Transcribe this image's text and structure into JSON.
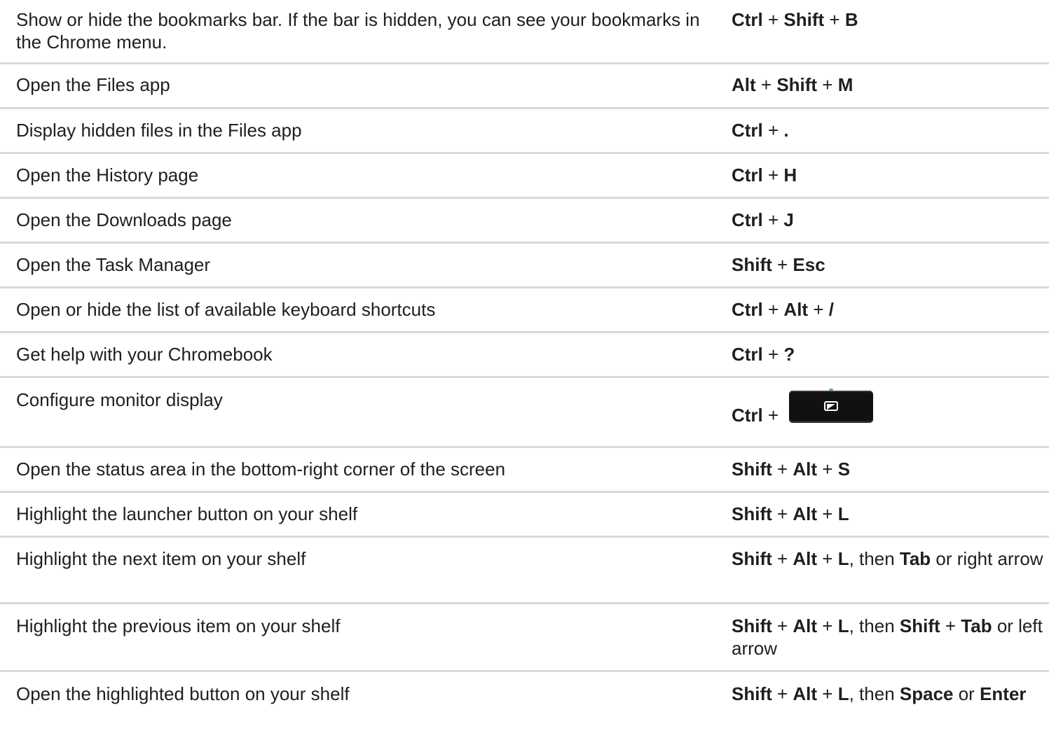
{
  "rows": [
    {
      "desc": "Show or hide the bookmarks bar. If the bar is hidden, you can see your bookmarks in the Chrome menu.",
      "keys": [
        {
          "b": "Ctrl"
        },
        {
          "t": " + "
        },
        {
          "b": "Shift"
        },
        {
          "t": " + "
        },
        {
          "b": "B"
        }
      ]
    },
    {
      "desc": "Open the Files app",
      "keys": [
        {
          "b": "Alt"
        },
        {
          "t": " + "
        },
        {
          "b": "Shift"
        },
        {
          "t": " + "
        },
        {
          "b": "M"
        }
      ]
    },
    {
      "desc": "Display hidden files in the Files app",
      "keys": [
        {
          "b": "Ctrl"
        },
        {
          "t": " + "
        },
        {
          "b": "."
        }
      ]
    },
    {
      "desc": "Open the History page",
      "keys": [
        {
          "b": "Ctrl"
        },
        {
          "t": " + "
        },
        {
          "b": "H"
        }
      ]
    },
    {
      "desc": "Open the Downloads page",
      "keys": [
        {
          "b": "Ctrl"
        },
        {
          "t": " + "
        },
        {
          "b": "J"
        }
      ]
    },
    {
      "desc": "Open the Task Manager",
      "keys": [
        {
          "b": "Shift"
        },
        {
          "t": " + "
        },
        {
          "b": "Esc"
        }
      ]
    },
    {
      "desc": "Open or hide the list of available keyboard shortcuts",
      "keys": [
        {
          "b": "Ctrl"
        },
        {
          "t": " + "
        },
        {
          "b": "Alt"
        },
        {
          "t": " + "
        },
        {
          "b": "/"
        }
      ]
    },
    {
      "desc": "Get help with your Chromebook",
      "keys": [
        {
          "b": "Ctrl"
        },
        {
          "t": " + "
        },
        {
          "b": "?"
        }
      ]
    },
    {
      "desc": "Configure monitor display",
      "keys": [
        {
          "b": "Ctrl"
        },
        {
          "t": " + "
        },
        {
          "icon": "monitor-display-key-icon"
        }
      ]
    },
    {
      "desc": "Open the status area in the bottom-right corner of the screen",
      "keys": [
        {
          "b": "Shift"
        },
        {
          "t": " + "
        },
        {
          "b": "Alt"
        },
        {
          "t": " + "
        },
        {
          "b": "S"
        }
      ]
    },
    {
      "desc": "Highlight the launcher button on your shelf",
      "keys": [
        {
          "b": "Shift"
        },
        {
          "t": " + "
        },
        {
          "b": "Alt"
        },
        {
          "t": " + "
        },
        {
          "b": "L"
        }
      ]
    },
    {
      "desc": "Highlight the next item on your shelf",
      "keys": [
        {
          "b": "Shift"
        },
        {
          "t": " + "
        },
        {
          "b": "Alt"
        },
        {
          "t": " + "
        },
        {
          "b": "L"
        },
        {
          "t": ", then "
        },
        {
          "b": "Tab"
        },
        {
          "t": " or right arrow"
        }
      ]
    },
    {
      "desc": "Highlight the previous item on your shelf",
      "keys": [
        {
          "b": "Shift"
        },
        {
          "t": " + "
        },
        {
          "b": "Alt"
        },
        {
          "t": " + "
        },
        {
          "b": "L"
        },
        {
          "t": ", then "
        },
        {
          "b": "Shift"
        },
        {
          "t": " + "
        },
        {
          "b": "Tab"
        },
        {
          "t": " or left arrow"
        }
      ]
    },
    {
      "desc": "Open the highlighted button on your shelf",
      "keys": [
        {
          "b": "Shift"
        },
        {
          "t": " + "
        },
        {
          "b": "Alt"
        },
        {
          "t": " + "
        },
        {
          "b": "L"
        },
        {
          "t": ", then "
        },
        {
          "b": "Space"
        },
        {
          "t": " or "
        },
        {
          "b": "Enter"
        }
      ]
    }
  ]
}
